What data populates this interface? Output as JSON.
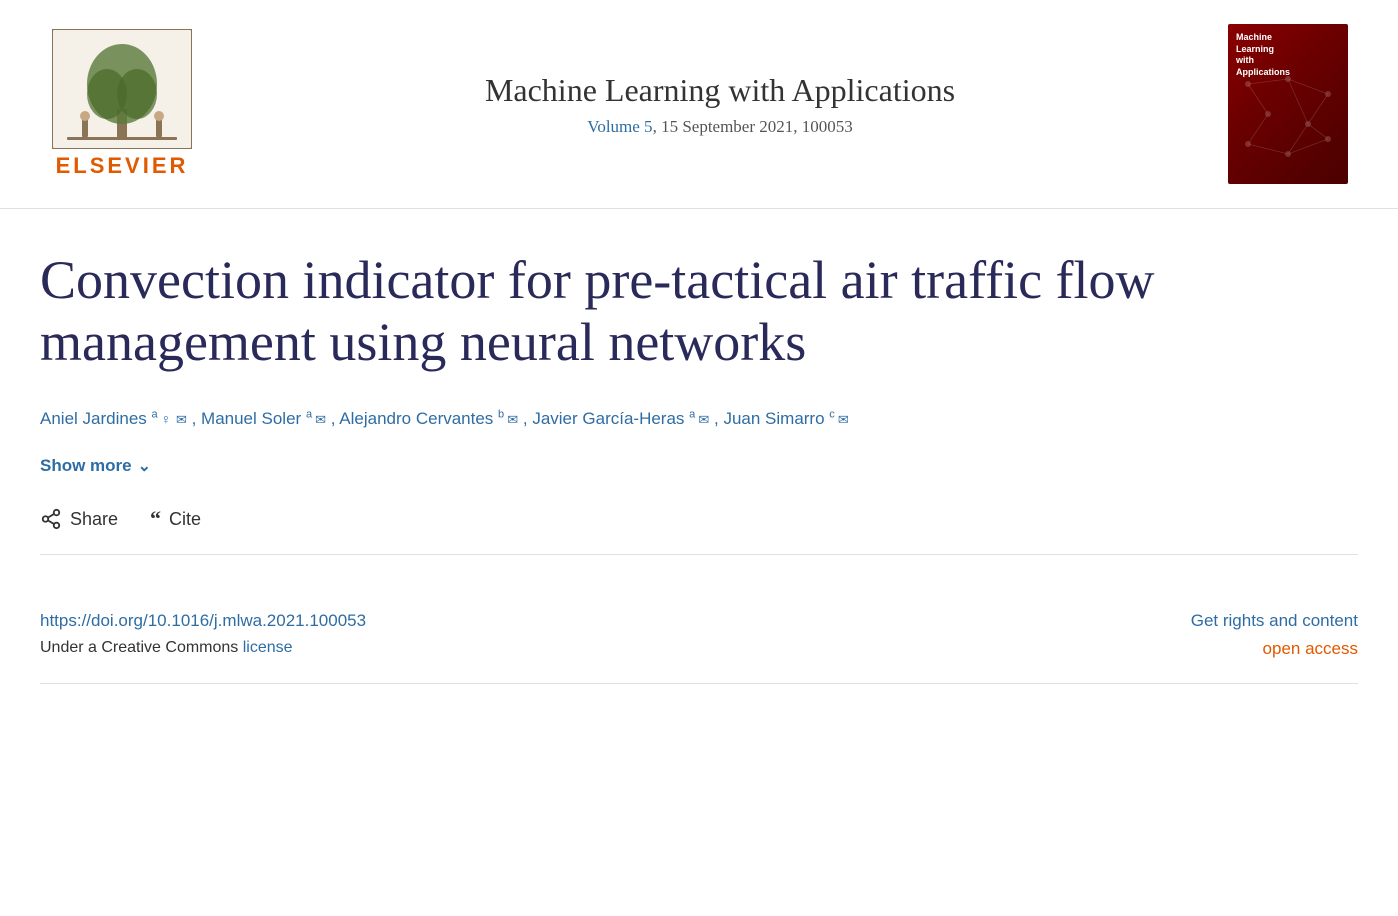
{
  "header": {
    "elsevier_label": "ELSEVIER",
    "journal_title": "Machine Learning with Applications",
    "journal_meta_volume": "Volume 5",
    "journal_meta_rest": ", 15 September 2021, 100053",
    "cover_title_line1": "Machine",
    "cover_title_line2": "Learning",
    "cover_title_line3": "with",
    "cover_title_line4": "Applications"
  },
  "article": {
    "title": "Convection indicator for pre-tactical air traffic flow management using neural networks",
    "authors": "Aniel Jardines a ♀ ✉, Manuel Soler a ✉, Alejandro Cervantes b ✉, Javier García-Heras a ✉, Juan Simarro c ✉",
    "show_more_label": "Show more",
    "share_label": "Share",
    "cite_label": "Cite"
  },
  "footer": {
    "doi_url": "https://doi.org/10.1016/j.mlwa.2021.100053",
    "license_text": "Under a Creative Commons",
    "license_link_text": "license",
    "get_rights_label": "Get rights and content",
    "open_access_label": "open access"
  },
  "icons": {
    "share": "share-icon",
    "cite": "quote-icon",
    "chevron": "chevron-down-icon",
    "person": "person-icon",
    "envelope": "envelope-icon"
  }
}
